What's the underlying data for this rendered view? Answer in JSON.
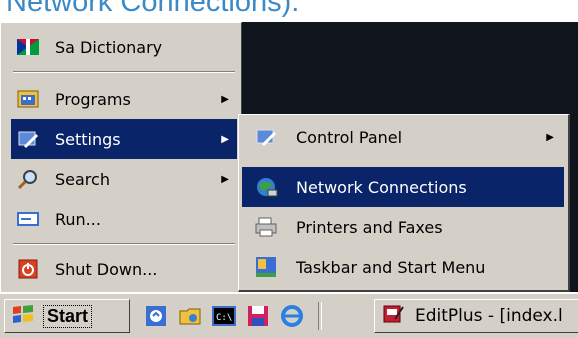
{
  "caption": "Network Connections).",
  "start_menu": {
    "items": [
      {
        "label": "Sa Dictionary",
        "icon": "flag-icon",
        "has_arrow": false
      },
      {
        "label": "Programs",
        "icon": "programs-icon",
        "has_arrow": true
      },
      {
        "label": "Settings",
        "icon": "settings-icon",
        "has_arrow": true,
        "selected": true
      },
      {
        "label": "Search",
        "icon": "search-icon",
        "has_arrow": true
      },
      {
        "label": "Run...",
        "icon": "run-icon",
        "has_arrow": false
      },
      {
        "label": "Shut Down...",
        "icon": "shutdown-icon",
        "has_arrow": false
      }
    ]
  },
  "settings_submenu": {
    "items": [
      {
        "label": "Control Panel",
        "icon": "control-panel-icon",
        "has_arrow": true
      },
      {
        "label": "Network Connections",
        "icon": "network-connections-icon",
        "selected": true
      },
      {
        "label": "Printers and Faxes",
        "icon": "printers-icon"
      },
      {
        "label": "Taskbar and Start Menu",
        "icon": "taskbar-icon"
      }
    ]
  },
  "taskbar": {
    "start_label": "Start",
    "quick_launch": [
      "explorer-icon",
      "folder-icon",
      "command-prompt-icon",
      "save-icon",
      "ie-icon"
    ],
    "task_label": "EditPlus - [index.l"
  },
  "colors": {
    "menu_bg": "#d4d0c8",
    "highlight": "#0a246a",
    "desktop": "#10141c",
    "caption": "#3a8ac8"
  }
}
